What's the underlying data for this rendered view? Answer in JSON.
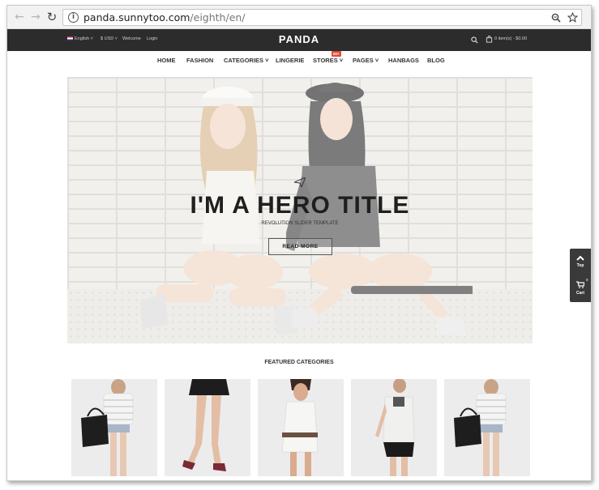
{
  "browser": {
    "url_host": "panda.sunnytoo.com",
    "url_path": "/eighth/en/",
    "info_icon": "i"
  },
  "topbar": {
    "language": "English",
    "currency": "$ USD",
    "welcome": "Welcome",
    "login": "Login",
    "logo": "PANDA",
    "cart_summary": "0 item(s) - $0.00"
  },
  "menu": {
    "items": [
      "Home",
      "Fashion",
      "Categories",
      "Lingerie",
      "Stores",
      "Pages",
      "Hanbags",
      "Blog"
    ],
    "stores_badge": "50+"
  },
  "hero": {
    "title": "I'M A HERO TITLE",
    "subtitle": "REVOLUTION SLIDER TEMPLATE",
    "button": "READ MORE"
  },
  "featured": {
    "title": "FEATURED CATEGORIES"
  },
  "widget": {
    "top_label": "Top",
    "cart_label": "Cart",
    "cart_count": "0"
  }
}
